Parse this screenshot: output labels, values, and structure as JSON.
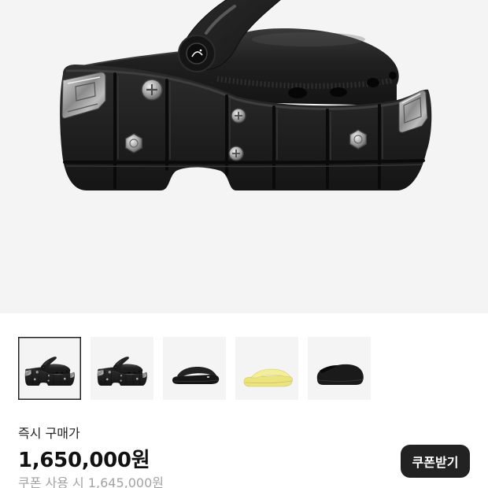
{
  "colors": {
    "accent": "#222222",
    "hero_background": "#f4f4f4",
    "thumbnail_background": "#f4f4f4",
    "muted_text": "#a3a3a3",
    "yellow_sandal": "#ebe37d",
    "yellow_sandal_light": "#f3ee9a"
  },
  "hero": {
    "icon": "studded-clog-icon"
  },
  "gallery": {
    "selected_index": 0,
    "thumbnails": [
      {
        "icon": "studded-clog-icon"
      },
      {
        "icon": "studded-clog-icon"
      },
      {
        "icon": "black-slide-icon"
      },
      {
        "icon": "yellow-slide-icon"
      },
      {
        "icon": "black-clog-icon"
      }
    ]
  },
  "price": {
    "label": "즉시 구매가",
    "amount": "1,650,000원",
    "coupon_button": "쿠폰받기",
    "coupon_price": "쿠폰 사용 시 1,645,000원"
  }
}
